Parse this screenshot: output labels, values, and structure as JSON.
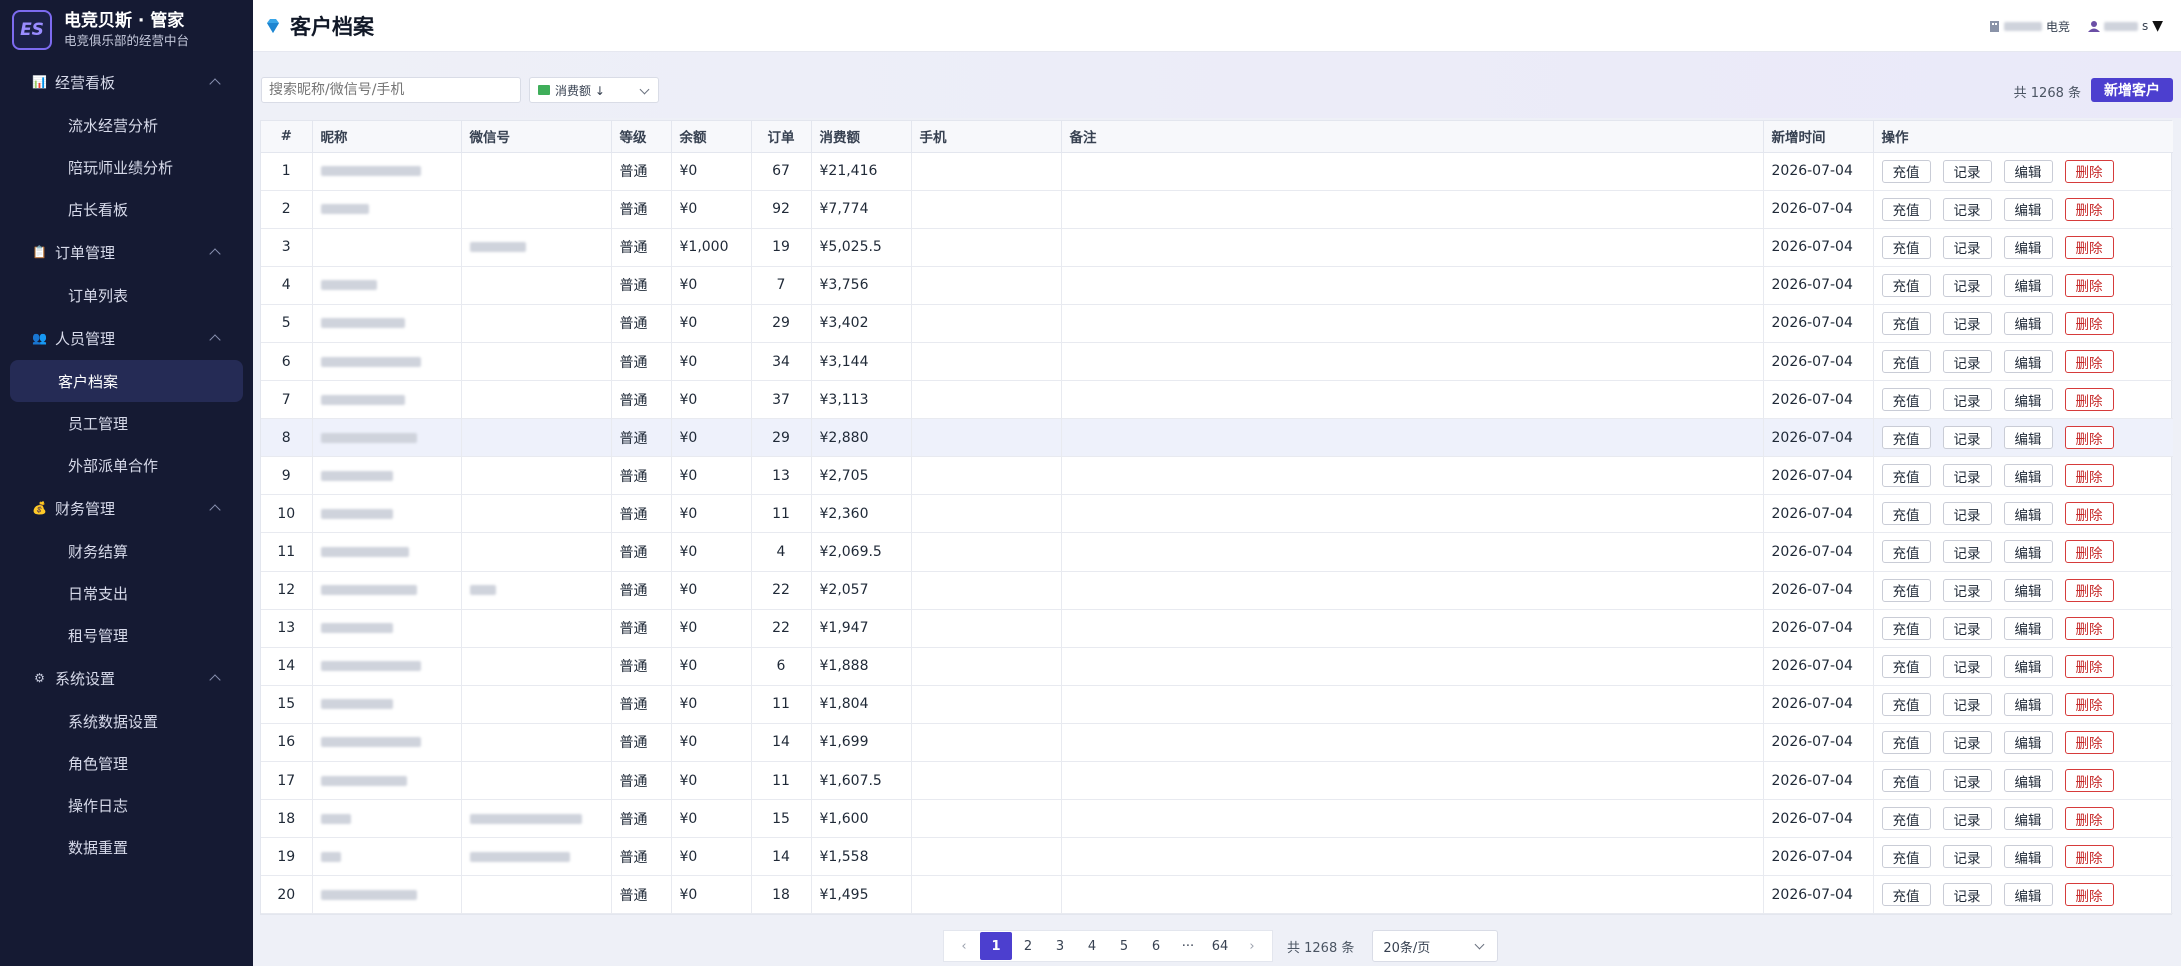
{
  "brand": {
    "logo_text": "ES",
    "title": "电竞贝斯 · 管家",
    "subtitle": "电竞俱乐部的经营中台"
  },
  "sidebar": [
    {
      "label": "经营看板",
      "icon": "chart-icon",
      "items": [
        "流水经营分析",
        "陪玩师业绩分析",
        "店长看板"
      ]
    },
    {
      "label": "订单管理",
      "icon": "clipboard-icon",
      "items": [
        "订单列表"
      ]
    },
    {
      "label": "人员管理",
      "icon": "people-icon",
      "items": [
        "客户档案",
        "员工管理",
        "外部派单合作"
      ]
    },
    {
      "label": "财务管理",
      "icon": "moneybag-icon",
      "items": [
        "财务结算",
        "日常支出",
        "租号管理"
      ]
    },
    {
      "label": "系统设置",
      "icon": "gear-icon",
      "items": [
        "系统数据设置",
        "角色管理",
        "操作日志",
        "数据重置"
      ]
    }
  ],
  "active_item": "客户档案",
  "header": {
    "title": "客户档案",
    "club_suffix": "电竞",
    "user_suffix": "s",
    "user_menu_arrow": "▼"
  },
  "toolbar": {
    "search_placeholder": "搜索昵称/微信号/手机",
    "sort_label": "消费额 ↓",
    "total_text": "共 1268 条",
    "add_label": "新增客户"
  },
  "table": {
    "columns": [
      "#",
      "昵称",
      "微信号",
      "等级",
      "余额",
      "订单",
      "消费额",
      "手机",
      "备注",
      "新增时间",
      "操作"
    ],
    "actions": [
      "充值",
      "记录",
      "编辑",
      "删除"
    ],
    "highlight_row": 8,
    "rows": [
      {
        "no": "1",
        "wechat_blurred": false,
        "level": "普通",
        "balance": "¥0",
        "orders": "67",
        "spend": "¥21,416",
        "date": "2026-07-04"
      },
      {
        "no": "2",
        "wechat_blurred": false,
        "level": "普通",
        "balance": "¥0",
        "orders": "92",
        "spend": "¥7,774",
        "date": "2026-07-04"
      },
      {
        "no": "3",
        "wechat_blurred": true,
        "level": "普通",
        "balance": "¥1,000",
        "orders": "19",
        "spend": "¥5,025.5",
        "date": "2026-07-04"
      },
      {
        "no": "4",
        "wechat_blurred": false,
        "level": "普通",
        "balance": "¥0",
        "orders": "7",
        "spend": "¥3,756",
        "date": "2026-07-04"
      },
      {
        "no": "5",
        "wechat_blurred": false,
        "level": "普通",
        "balance": "¥0",
        "orders": "29",
        "spend": "¥3,402",
        "date": "2026-07-04"
      },
      {
        "no": "6",
        "wechat_blurred": false,
        "level": "普通",
        "balance": "¥0",
        "orders": "34",
        "spend": "¥3,144",
        "date": "2026-07-04"
      },
      {
        "no": "7",
        "wechat_blurred": false,
        "level": "普通",
        "balance": "¥0",
        "orders": "37",
        "spend": "¥3,113",
        "date": "2026-07-04"
      },
      {
        "no": "8",
        "wechat_blurred": false,
        "level": "普通",
        "balance": "¥0",
        "orders": "29",
        "spend": "¥2,880",
        "date": "2026-07-04"
      },
      {
        "no": "9",
        "wechat_blurred": false,
        "level": "普通",
        "balance": "¥0",
        "orders": "13",
        "spend": "¥2,705",
        "date": "2026-07-04"
      },
      {
        "no": "10",
        "wechat_blurred": false,
        "level": "普通",
        "balance": "¥0",
        "orders": "11",
        "spend": "¥2,360",
        "date": "2026-07-04"
      },
      {
        "no": "11",
        "wechat_blurred": false,
        "level": "普通",
        "balance": "¥0",
        "orders": "4",
        "spend": "¥2,069.5",
        "date": "2026-07-04"
      },
      {
        "no": "12",
        "wechat_blurred": true,
        "level": "普通",
        "balance": "¥0",
        "orders": "22",
        "spend": "¥2,057",
        "date": "2026-07-04"
      },
      {
        "no": "13",
        "wechat_blurred": false,
        "level": "普通",
        "balance": "¥0",
        "orders": "22",
        "spend": "¥1,947",
        "date": "2026-07-04"
      },
      {
        "no": "14",
        "wechat_blurred": false,
        "level": "普通",
        "balance": "¥0",
        "orders": "6",
        "spend": "¥1,888",
        "date": "2026-07-04"
      },
      {
        "no": "15",
        "wechat_blurred": false,
        "level": "普通",
        "balance": "¥0",
        "orders": "11",
        "spend": "¥1,804",
        "date": "2026-07-04"
      },
      {
        "no": "16",
        "wechat_blurred": false,
        "level": "普通",
        "balance": "¥0",
        "orders": "14",
        "spend": "¥1,699",
        "date": "2026-07-04"
      },
      {
        "no": "17",
        "wechat_blurred": false,
        "level": "普通",
        "balance": "¥0",
        "orders": "11",
        "spend": "¥1,607.5",
        "date": "2026-07-04"
      },
      {
        "no": "18",
        "wechat_blurred": true,
        "level": "普通",
        "balance": "¥0",
        "orders": "15",
        "spend": "¥1,600",
        "date": "2026-07-04"
      },
      {
        "no": "19",
        "wechat_blurred": true,
        "level": "普通",
        "balance": "¥0",
        "orders": "14",
        "spend": "¥1,558",
        "date": "2026-07-04"
      },
      {
        "no": "20",
        "wechat_blurred": false,
        "level": "普通",
        "balance": "¥0",
        "orders": "18",
        "spend": "¥1,495",
        "date": "2026-07-04"
      }
    ]
  },
  "pagination": {
    "pages": [
      "1",
      "2",
      "3",
      "4",
      "5",
      "6",
      "···",
      "64"
    ],
    "current": "1",
    "prev": "‹",
    "next": "›",
    "total_text": "共 1268 条",
    "page_size": "20条/页"
  },
  "colors": {
    "sidebar_bg": "#151a33",
    "accent": "#4c3fcf",
    "danger": "#d63b3b"
  }
}
